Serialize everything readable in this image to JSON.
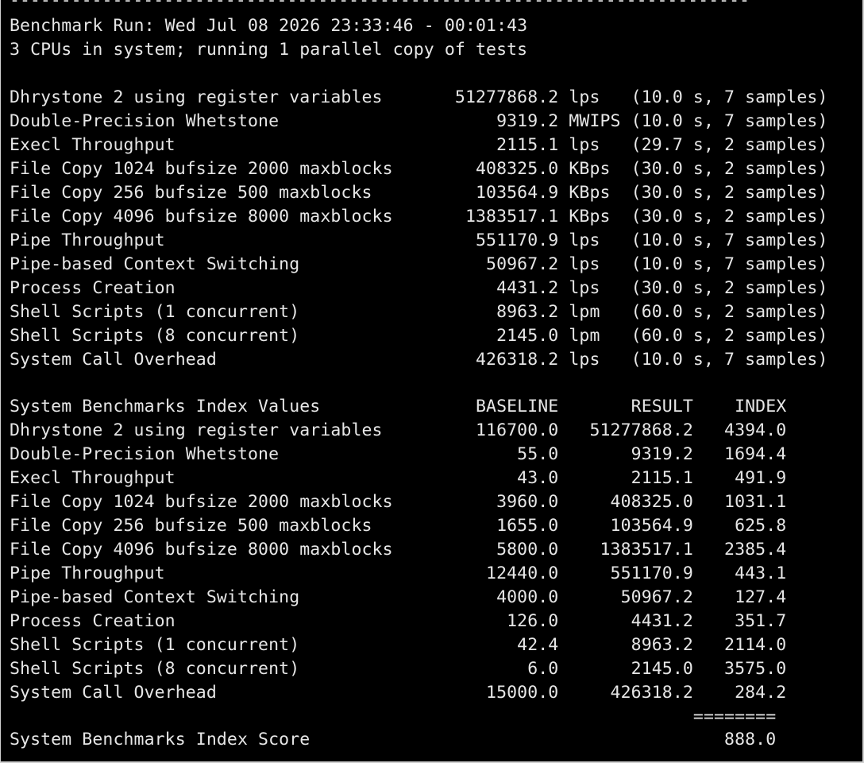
{
  "terminal": {
    "rule": "------------------------------------------------------------------------",
    "header_line": "Benchmark Run: Wed Jul 08 2026 23:33:46 - 00:01:43",
    "cpu_line": "3 CPUs in system; running 1 parallel copy of tests",
    "results": [
      "Dhrystone 2 using register variables       51277868.2 lps   (10.0 s, 7 samples)",
      "Double-Precision Whetstone                     9319.2 MWIPS (10.0 s, 7 samples)",
      "Execl Throughput                               2115.1 lps   (29.7 s, 2 samples)",
      "File Copy 1024 bufsize 2000 maxblocks        408325.0 KBps  (30.0 s, 2 samples)",
      "File Copy 256 bufsize 500 maxblocks          103564.9 KBps  (30.0 s, 2 samples)",
      "File Copy 4096 bufsize 8000 maxblocks       1383517.1 KBps  (30.0 s, 2 samples)",
      "Pipe Throughput                              551170.9 lps   (10.0 s, 7 samples)",
      "Pipe-based Context Switching                  50967.2 lps   (10.0 s, 7 samples)",
      "Process Creation                               4431.2 lps   (30.0 s, 2 samples)",
      "Shell Scripts (1 concurrent)                   8963.2 lpm   (60.0 s, 2 samples)",
      "Shell Scripts (8 concurrent)                   2145.0 lpm   (60.0 s, 2 samples)",
      "System Call Overhead                         426318.2 lps   (10.0 s, 7 samples)"
    ],
    "index_header": "System Benchmarks Index Values               BASELINE       RESULT    INDEX",
    "index_rows": [
      "Dhrystone 2 using register variables         116700.0   51277868.2   4394.0",
      "Double-Precision Whetstone                       55.0       9319.2   1694.4",
      "Execl Throughput                                 43.0       2115.1    491.9",
      "File Copy 1024 bufsize 2000 maxblocks          3960.0     408325.0   1031.1",
      "File Copy 256 bufsize 500 maxblocks            1655.0     103564.9    625.8",
      "File Copy 4096 bufsize 8000 maxblocks          5800.0    1383517.1   2385.4",
      "Pipe Throughput                               12440.0     551170.9    443.1",
      "Pipe-based Context Switching                   4000.0      50967.2    127.4",
      "Process Creation                                126.0       4431.2    351.7",
      "Shell Scripts (1 concurrent)                     42.4       8963.2   2114.0",
      "Shell Scripts (8 concurrent)                      6.0       2145.0   3575.0",
      "System Call Overhead                          15000.0     426318.2    284.2"
    ],
    "score_separator": "                                                                  ========",
    "score_line": "System Benchmarks Index Score                                        888.0"
  }
}
